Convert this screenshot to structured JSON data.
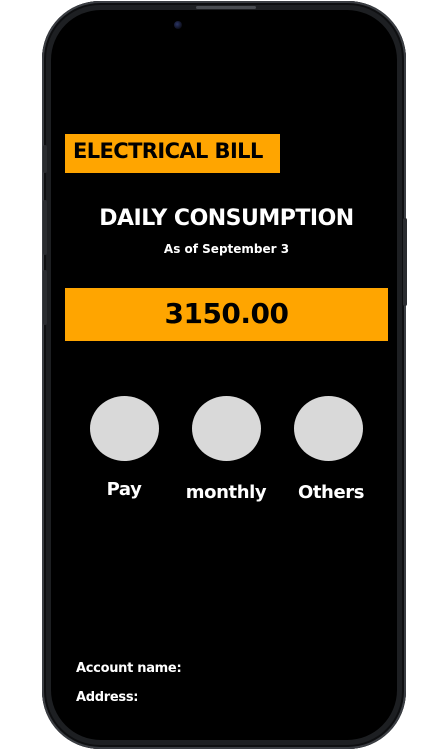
{
  "app": {
    "title": "ELECTRICAL BILL"
  },
  "consumption": {
    "heading": "DAILY CONSUMPTION",
    "as_of": "As of September 3",
    "amount": "3150.00"
  },
  "actions": [
    {
      "label": "Pay",
      "icon": "circle-button"
    },
    {
      "label": "monthly",
      "icon": "circle-button"
    },
    {
      "label": "Others",
      "icon": "circle-button"
    }
  ],
  "account": {
    "name_label": "Account name:",
    "address_label": "Address:"
  },
  "colors": {
    "accent": "#ffa500",
    "background": "#000000",
    "button": "#d9d9d9",
    "text": "#ffffff"
  }
}
